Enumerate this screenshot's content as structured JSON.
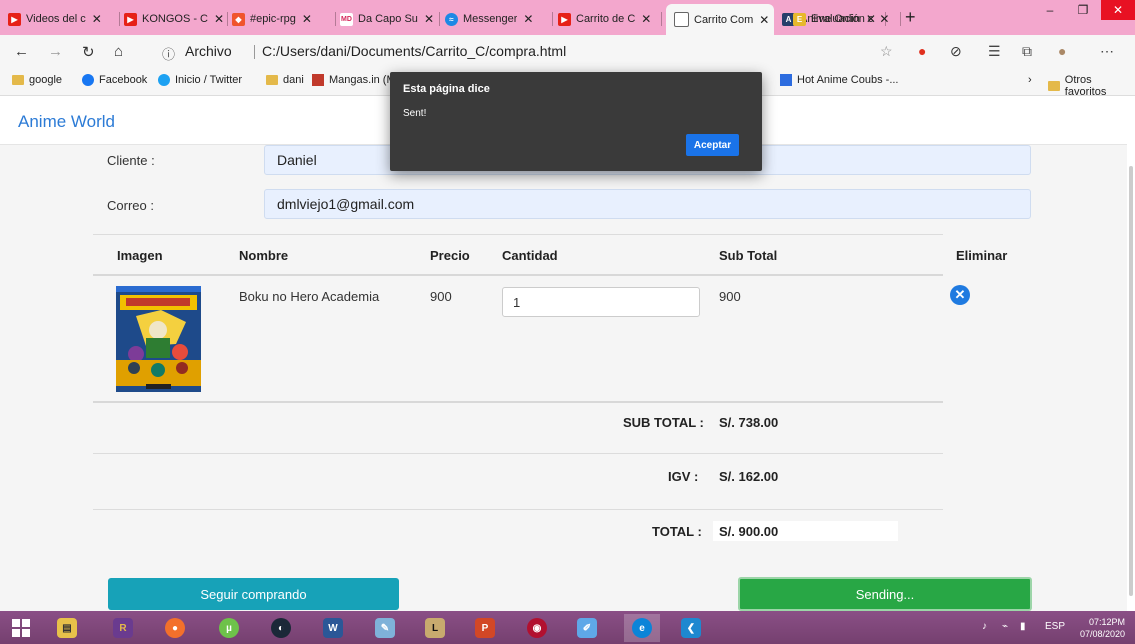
{
  "browser": {
    "tabs": [
      {
        "label": "Videos del c",
        "color": "#e62117"
      },
      {
        "label": "KONGOS - C",
        "color": "#e62117"
      },
      {
        "label": "#epic-rpg",
        "color": "#f0542c"
      },
      {
        "label": "Da Capo Su",
        "color": "#d5295c"
      },
      {
        "label": "Messenger",
        "color": "#1e88e5"
      },
      {
        "label": "Carrito de C",
        "color": "#e62117"
      },
      {
        "label": "Carrito Com",
        "color": "#666666"
      },
      {
        "label": "Anime Onlin",
        "color": "#263e6a"
      },
      {
        "label": "Evaluación c",
        "color": "#e7b82c"
      }
    ],
    "new_tab": "+",
    "url_prefix": "Archivo",
    "url": "C:/Users/dani/Documents/Carrito_C/compra.html",
    "bookmarks": [
      "google",
      "Facebook",
      "Inicio / Twitter",
      "dani",
      "Mangas.in (M",
      "Hot Anime Coubs -..."
    ],
    "other_favorites": "Otros favoritos"
  },
  "page": {
    "brand": "Anime World",
    "form": {
      "cliente_label": "Cliente :",
      "cliente_value": "Daniel",
      "correo_label": "Correo :",
      "correo_value": "dmlviejo1@gmail.com"
    },
    "table": {
      "headers": [
        "Imagen",
        "Nombre",
        "Precio",
        "Cantidad",
        "Sub Total",
        "Eliminar"
      ],
      "rows": [
        {
          "nombre": "Boku no Hero Academia",
          "precio": "900",
          "cantidad": "1",
          "subtotal": "900"
        }
      ]
    },
    "summary": {
      "subtotal_label": "SUB TOTAL :",
      "subtotal_value": "S/. 738.00",
      "igv_label": "IGV :",
      "igv_value": "S/. 162.00",
      "total_label": "TOTAL :",
      "total_value": "S/. 900.00"
    },
    "buttons": {
      "continue": "Seguir comprando",
      "sending": "Sending..."
    }
  },
  "dialog": {
    "title": "Esta página dice",
    "message": "Sent!",
    "ok": "Aceptar"
  },
  "taskbar": {
    "language": "ESP",
    "time": "07:12PM",
    "date": "07/08/2020"
  }
}
